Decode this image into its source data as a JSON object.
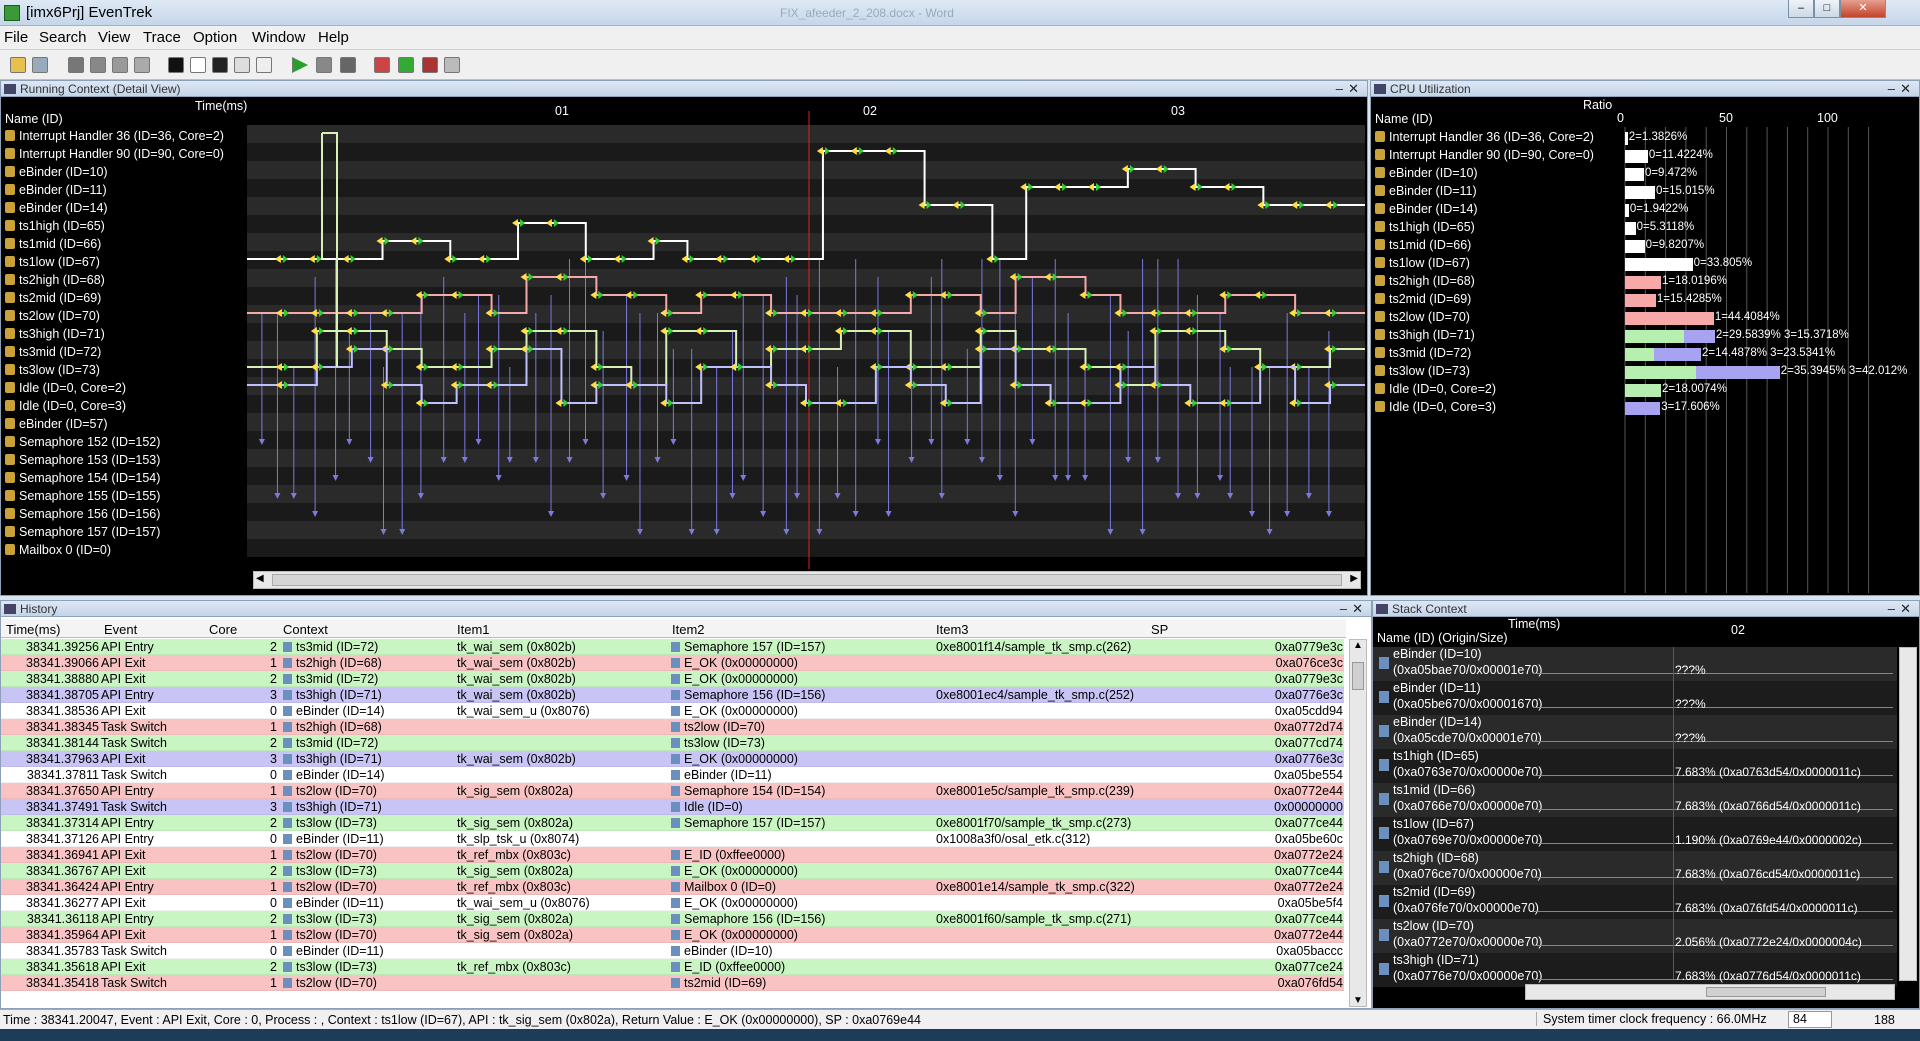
{
  "window": {
    "title": "[imx6Prj] EvenTrek",
    "ghost_title": "FIX_afeeder_2_208.docx - Word"
  },
  "menu": [
    "File",
    "Search",
    "View",
    "Trace",
    "Option",
    "Window",
    "Help"
  ],
  "running_context": {
    "title": "Running Context (Detail View)",
    "col_time": "Time(ms)",
    "col_name": "Name (ID)",
    "ticks": [
      "01",
      "02",
      "03"
    ],
    "rows": [
      "Interrupt Handler 36 (ID=36, Core=2)",
      "Interrupt Handler 90 (ID=90, Core=0)",
      "eBinder (ID=10)",
      "eBinder (ID=11)",
      "eBinder (ID=14)",
      "ts1high (ID=65)",
      "ts1mid (ID=66)",
      "ts1low (ID=67)",
      "ts2high (ID=68)",
      "ts2mid (ID=69)",
      "ts2low (ID=70)",
      "ts3high (ID=71)",
      "ts3mid (ID=72)",
      "ts3low (ID=73)",
      "Idle (ID=0, Core=2)",
      "Idle (ID=0, Core=3)",
      "eBinder (ID=57)",
      "Semaphore 152 (ID=152)",
      "Semaphore 153 (ID=153)",
      "Semaphore 154 (ID=154)",
      "Semaphore 155 (ID=155)",
      "Semaphore 156 (ID=156)",
      "Semaphore 157 (ID=157)",
      "Mailbox 0 (ID=0)"
    ]
  },
  "cpu": {
    "title": "CPU Utilization",
    "col_ratio": "Ratio",
    "col_name": "Name (ID)",
    "ticks": [
      "0",
      "50",
      "100"
    ],
    "rows": [
      {
        "name": "Interrupt Handler 36 (ID=36, Core=2)",
        "label": "2=1.3826%",
        "bars": [
          {
            "c": "#ffffff",
            "v": 1.38
          }
        ]
      },
      {
        "name": "Interrupt Handler 90 (ID=90, Core=0)",
        "label": "0=11.4224%",
        "bars": [
          {
            "c": "#ffffff",
            "v": 11.42
          }
        ]
      },
      {
        "name": "eBinder (ID=10)",
        "label": "0=9.472%",
        "bars": [
          {
            "c": "#ffffff",
            "v": 9.47
          }
        ]
      },
      {
        "name": "eBinder (ID=11)",
        "label": "0=15.015%",
        "bars": [
          {
            "c": "#ffffff",
            "v": 15.02
          }
        ]
      },
      {
        "name": "eBinder (ID=14)",
        "label": "0=1.9422%",
        "bars": [
          {
            "c": "#ffffff",
            "v": 1.94
          }
        ]
      },
      {
        "name": "ts1high (ID=65)",
        "label": "0=5.3118%",
        "bars": [
          {
            "c": "#ffffff",
            "v": 5.31
          }
        ]
      },
      {
        "name": "ts1mid (ID=66)",
        "label": "0=9.8207%",
        "bars": [
          {
            "c": "#ffffff",
            "v": 9.82
          }
        ]
      },
      {
        "name": "ts1low (ID=67)",
        "label": "0=33.805%",
        "bars": [
          {
            "c": "#ffffff",
            "v": 33.81
          }
        ]
      },
      {
        "name": "ts2high (ID=68)",
        "label": "1=18.0196%",
        "bars": [
          {
            "c": "#f7a8a8",
            "v": 18.02
          }
        ]
      },
      {
        "name": "ts2mid (ID=69)",
        "label": "1=15.4285%",
        "bars": [
          {
            "c": "#f7a8a8",
            "v": 15.43
          }
        ]
      },
      {
        "name": "ts2low (ID=70)",
        "label": "1=44.4084%",
        "bars": [
          {
            "c": "#f7a8a8",
            "v": 44.41
          }
        ]
      },
      {
        "name": "ts3high (ID=71)",
        "label": "2=29.5839% 3=15.3718%",
        "bars": [
          {
            "c": "#b6efaf",
            "v": 29.58
          },
          {
            "c": "#a7a3f0",
            "v": 15.37
          }
        ]
      },
      {
        "name": "ts3mid (ID=72)",
        "label": "2=14.4878% 3=23.5341%",
        "bars": [
          {
            "c": "#b6efaf",
            "v": 14.49
          },
          {
            "c": "#a7a3f0",
            "v": 23.53
          }
        ]
      },
      {
        "name": "ts3low (ID=73)",
        "label": "2=35.3945% 3=42.012%",
        "bars": [
          {
            "c": "#b6efaf",
            "v": 35.39
          },
          {
            "c": "#a7a3f0",
            "v": 42.01
          }
        ]
      },
      {
        "name": "Idle (ID=0, Core=2)",
        "label": "2=18.0074%",
        "bars": [
          {
            "c": "#b6efaf",
            "v": 18.01
          }
        ]
      },
      {
        "name": "Idle (ID=0, Core=3)",
        "label": "3=17.606%",
        "bars": [
          {
            "c": "#a7a3f0",
            "v": 17.61
          }
        ]
      }
    ]
  },
  "history": {
    "title": "History",
    "cols": [
      "Time(ms)",
      "Event",
      "Core",
      "Context",
      "Item1",
      "Item2",
      "Item3",
      "SP"
    ],
    "rows": [
      [
        "38341.39256",
        "API Entry",
        "2",
        "ts3mid (ID=72)",
        "tk_wai_sem (0x802b)",
        "Semaphore 157 (ID=157)",
        "0xe8001f14/sample_tk_smp.c(262)",
        "0xa0779e3c",
        "#c9f5c3"
      ],
      [
        "38341.39066",
        "API Exit",
        "1",
        "ts2high (ID=68)",
        "tk_wai_sem (0x802b)",
        "E_OK (0x00000000)",
        "",
        "0xa076ce3c",
        "#f9c3c3"
      ],
      [
        "38341.38880",
        "API Exit",
        "2",
        "ts3mid (ID=72)",
        "tk_wai_sem (0x802b)",
        "E_OK (0x00000000)",
        "",
        "0xa0779e3c",
        "#c9f5c3"
      ],
      [
        "38341.38705",
        "API Entry",
        "3",
        "ts3high (ID=71)",
        "tk_wai_sem (0x802b)",
        "Semaphore 156 (ID=156)",
        "0xe8001ec4/sample_tk_smp.c(252)",
        "0xa0776e3c",
        "#c8c4f5"
      ],
      [
        "38341.38536",
        "API Exit",
        "0",
        "eBinder (ID=14)",
        "tk_wai_sem_u (0x8076)",
        "E_OK (0x00000000)",
        "",
        "0xa05cdd94",
        "#ffffff"
      ],
      [
        "38341.38345",
        "Task Switch",
        "1",
        "ts2high (ID=68)",
        "",
        "ts2low (ID=70)",
        "",
        "0xa0772d74",
        "#f9c3c3"
      ],
      [
        "38341.38144",
        "Task Switch",
        "2",
        "ts3mid (ID=72)",
        "",
        "ts3low (ID=73)",
        "",
        "0xa077cd74",
        "#c9f5c3"
      ],
      [
        "38341.37963",
        "API Exit",
        "3",
        "ts3high (ID=71)",
        "tk_wai_sem (0x802b)",
        "E_OK (0x00000000)",
        "",
        "0xa0776e3c",
        "#c8c4f5"
      ],
      [
        "38341.37811",
        "Task Switch",
        "0",
        "eBinder (ID=14)",
        "",
        "eBinder (ID=11)",
        "",
        "0xa05be554",
        "#ffffff"
      ],
      [
        "38341.37650",
        "API Entry",
        "1",
        "ts2low (ID=70)",
        "tk_sig_sem (0x802a)",
        "Semaphore 154 (ID=154)",
        "0xe8001e5c/sample_tk_smp.c(239)",
        "0xa0772e44",
        "#f9c3c3"
      ],
      [
        "38341.37491",
        "Task Switch",
        "3",
        "ts3high (ID=71)",
        "",
        "Idle (ID=0)",
        "",
        "0x00000000",
        "#c8c4f5"
      ],
      [
        "38341.37314",
        "API Entry",
        "2",
        "ts3low (ID=73)",
        "tk_sig_sem (0x802a)",
        "Semaphore 157 (ID=157)",
        "0xe8001f70/sample_tk_smp.c(273)",
        "0xa077ce44",
        "#c9f5c3"
      ],
      [
        "38341.37126",
        "API Entry",
        "0",
        "eBinder (ID=11)",
        "tk_slp_tsk_u (0x8074)",
        "",
        "0x1008a3f0/osal_etk.c(312)",
        "0xa05be60c",
        "#ffffff"
      ],
      [
        "38341.36941",
        "API Exit",
        "1",
        "ts2low (ID=70)",
        "tk_ref_mbx (0x803c)",
        "E_ID (0xffee0000)",
        "",
        "0xa0772e24",
        "#f9c3c3"
      ],
      [
        "38341.36767",
        "API Exit",
        "2",
        "ts3low (ID=73)",
        "tk_sig_sem (0x802a)",
        "E_OK (0x00000000)",
        "",
        "0xa077ce44",
        "#c9f5c3"
      ],
      [
        "38341.36424",
        "API Entry",
        "1",
        "ts2low (ID=70)",
        "tk_ref_mbx (0x803c)",
        "Mailbox 0 (ID=0)",
        "0xe8001e14/sample_tk_smp.c(322)",
        "0xa0772e24",
        "#f9c3c3"
      ],
      [
        "38341.36277",
        "API Exit",
        "0",
        "eBinder (ID=11)",
        "tk_wai_sem_u (0x8076)",
        "E_OK (0x00000000)",
        "",
        "0xa05be5f4",
        "#ffffff"
      ],
      [
        "38341.36118",
        "API Entry",
        "2",
        "ts3low (ID=73)",
        "tk_sig_sem (0x802a)",
        "Semaphore 156 (ID=156)",
        "0xe8001f60/sample_tk_smp.c(271)",
        "0xa077ce44",
        "#c9f5c3"
      ],
      [
        "38341.35964",
        "API Exit",
        "1",
        "ts2low (ID=70)",
        "tk_sig_sem (0x802a)",
        "E_OK (0x00000000)",
        "",
        "0xa0772e44",
        "#f9c3c3"
      ],
      [
        "38341.35783",
        "Task Switch",
        "0",
        "eBinder (ID=11)",
        "",
        "eBinder (ID=10)",
        "",
        "0xa05baccc",
        "#ffffff"
      ],
      [
        "38341.35618",
        "API Exit",
        "2",
        "ts3low (ID=73)",
        "tk_ref_mbx (0x803c)",
        "E_ID (0xffee0000)",
        "",
        "0xa077ce24",
        "#c9f5c3"
      ],
      [
        "38341.35418",
        "Task Switch",
        "1",
        "ts2low (ID=70)",
        "",
        "ts2mid (ID=69)",
        "",
        "0xa076fd54",
        "#f9c3c3"
      ]
    ]
  },
  "stack": {
    "title": "Stack Context",
    "col_time": "Time(ms)",
    "col_name": "Name (ID) (Origin/Size)",
    "tick": "02",
    "rows": [
      [
        "eBinder (ID=10)",
        "(0xa05bae70/0x00001e70)",
        "???%"
      ],
      [
        "eBinder (ID=11)",
        "(0xa05be670/0x00001670)",
        "???%"
      ],
      [
        "eBinder (ID=14)",
        "(0xa05cde70/0x00001e70)",
        "???%"
      ],
      [
        "ts1high (ID=65)",
        "(0xa0763e70/0x00000e70)",
        "7.683% (0xa0763d54/0x0000011c)"
      ],
      [
        "ts1mid (ID=66)",
        "(0xa0766e70/0x00000e70)",
        "7.683% (0xa0766d54/0x0000011c)"
      ],
      [
        "ts1low (ID=67)",
        "(0xa0769e70/0x00000e70)",
        "1.190% (0xa0769e44/0x0000002c)"
      ],
      [
        "ts2high (ID=68)",
        "(0xa076ce70/0x00000e70)",
        "7.683% (0xa076cd54/0x0000011c)"
      ],
      [
        "ts2mid (ID=69)",
        "(0xa076fe70/0x00000e70)",
        "7.683% (0xa076fd54/0x0000011c)"
      ],
      [
        "ts2low (ID=70)",
        "(0xa0772e70/0x00000e70)",
        "2.056% (0xa0772e24/0x0000004c)"
      ],
      [
        "ts3high (ID=71)",
        "(0xa0776e70/0x00000e70)",
        "7.683% (0xa0776d54/0x0000011c)"
      ]
    ]
  },
  "status": {
    "text": "Time : 38341.20047, Event : API Exit, Core : 0, Process : , Context : ts1low (ID=67), API : tk_sig_sem (0x802a), Return Value : E_OK (0x00000000), SP : 0xa0769e44",
    "clock_label": "System timer clock frequency : 66.0MHz",
    "spin_value": "84",
    "count": "188"
  }
}
